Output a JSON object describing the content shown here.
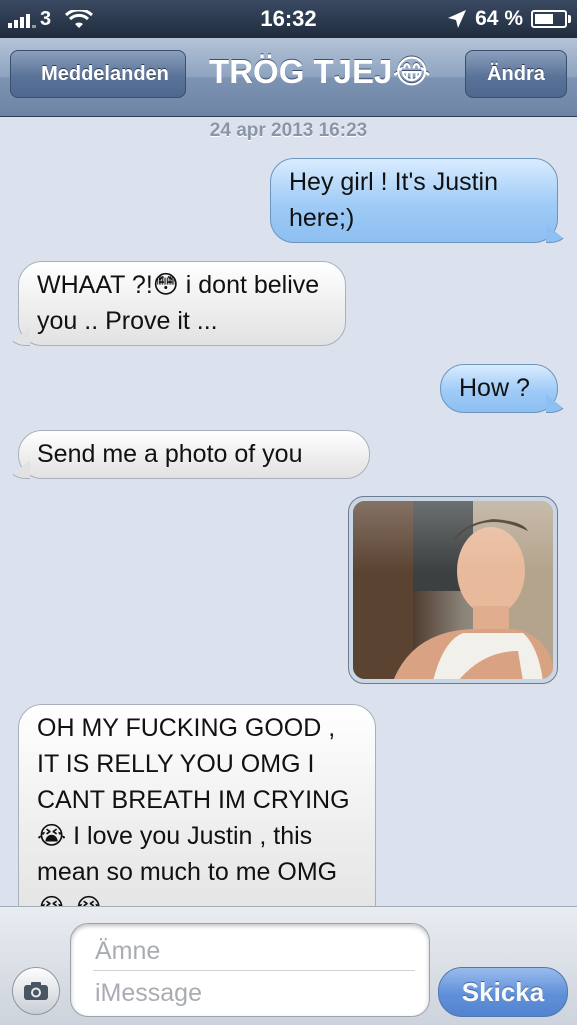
{
  "status_bar": {
    "carrier": "3",
    "time": "16:32",
    "battery": "64 %",
    "icons": [
      "signal-icon",
      "wifi-icon",
      "location-arrow-icon",
      "battery-icon"
    ],
    "battery_level": 0.64
  },
  "nav": {
    "back_label": "Meddelanden",
    "title": "TRÖG TJEJ",
    "title_emoji": "😂",
    "edit_label": "Ändra"
  },
  "conversation": {
    "timestamp": "24 apr 2013 16:23",
    "messages": [
      {
        "side": "out",
        "text": "Hey girl ! It's Justin here;)"
      },
      {
        "side": "in",
        "text_a": "WHAAT ?!",
        "emoji": "😳",
        "text_b": " i dont belive you .. Prove it ..."
      },
      {
        "side": "out",
        "text": "How ?"
      },
      {
        "side": "in",
        "text": "Send me a photo of you"
      },
      {
        "side": "out",
        "type": "photo"
      },
      {
        "side": "in",
        "text_a": "OH MY FUCKING GOOD , IT IS RELLY YOU OMG I CANT BREATH IM CRYING ",
        "emoji": "😭",
        "text_b": " I love you Justin , this mean so much to me OMG ",
        "emoji_end": "😭 😭"
      }
    ]
  },
  "compose": {
    "subject_placeholder": "Ämne",
    "message_placeholder": "iMessage",
    "send_label": "Skicka"
  },
  "colors": {
    "background": "#dbe2ed",
    "outgoing_bubble": "#9fcbf6",
    "incoming_bubble": "#eeeeee",
    "send_button": "#4c84d8"
  }
}
